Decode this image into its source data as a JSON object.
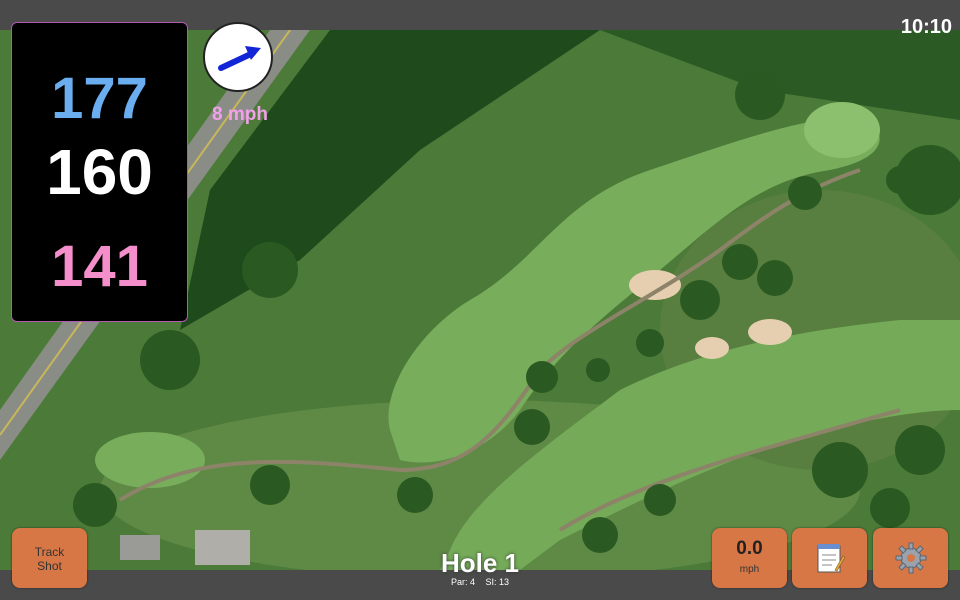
{
  "status": {
    "time": "10:10"
  },
  "yardage": {
    "back": "177",
    "middle": "160",
    "front": "141"
  },
  "wind": {
    "speed_label": "8 mph",
    "direction_icon": "wind-arrow-icon"
  },
  "hole": {
    "title": "Hole 1",
    "par_label": "Par: 4",
    "si_label": "SI: 13"
  },
  "buttons": {
    "track_line1": "Track",
    "track_line2": "Shot",
    "speed_value": "0.0",
    "speed_unit": "mph",
    "notes_icon": "notepad-icon",
    "settings_icon": "gear-icon"
  },
  "colors": {
    "back_yardage": "#6aaef0",
    "middle_yardage": "#ffffff",
    "front_yardage": "#f48fcb",
    "wind_text": "#f2a0ea",
    "button": "#d77746"
  }
}
